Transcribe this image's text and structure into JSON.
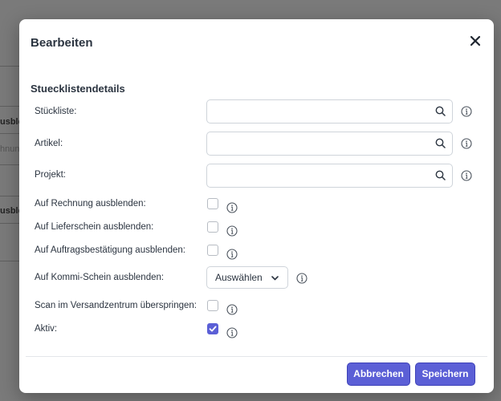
{
  "background": {
    "fragments": [
      "usble",
      "hnung",
      "usble"
    ]
  },
  "dialog": {
    "title": "Bearbeiten",
    "section_title": "Stuecklistendetails",
    "fields": {
      "stueckliste": {
        "label": "Stückliste:",
        "value": "",
        "placeholder": ""
      },
      "artikel": {
        "label": "Artikel:",
        "value": "",
        "placeholder": ""
      },
      "projekt": {
        "label": "Projekt:",
        "value": "",
        "placeholder": ""
      }
    },
    "checkboxes": {
      "rechnung": {
        "label": "Auf Rechnung ausblenden:",
        "checked": false
      },
      "lieferschein": {
        "label": "Auf Lieferschein ausblenden:",
        "checked": false
      },
      "auftragsbestaetigung": {
        "label": "Auf Auftragsbestätigung ausblenden:",
        "checked": false
      },
      "versandzentrum": {
        "label": "Scan im Versandzentrum überspringen:",
        "checked": false
      },
      "aktiv": {
        "label": "Aktiv:",
        "checked": true
      }
    },
    "kommi": {
      "label": "Auf Kommi-Schein ausblenden:",
      "selected": "Auswählen"
    },
    "buttons": {
      "cancel": "Abbrechen",
      "save": "Speichern"
    }
  },
  "colors": {
    "accent": "#5b5fd6",
    "text": "#2b3440",
    "border": "#cfd4da"
  },
  "icons": {
    "close": "close-icon",
    "search": "search-icon",
    "info": "info-icon",
    "chevron": "chevron-down-icon",
    "check": "check-icon"
  }
}
